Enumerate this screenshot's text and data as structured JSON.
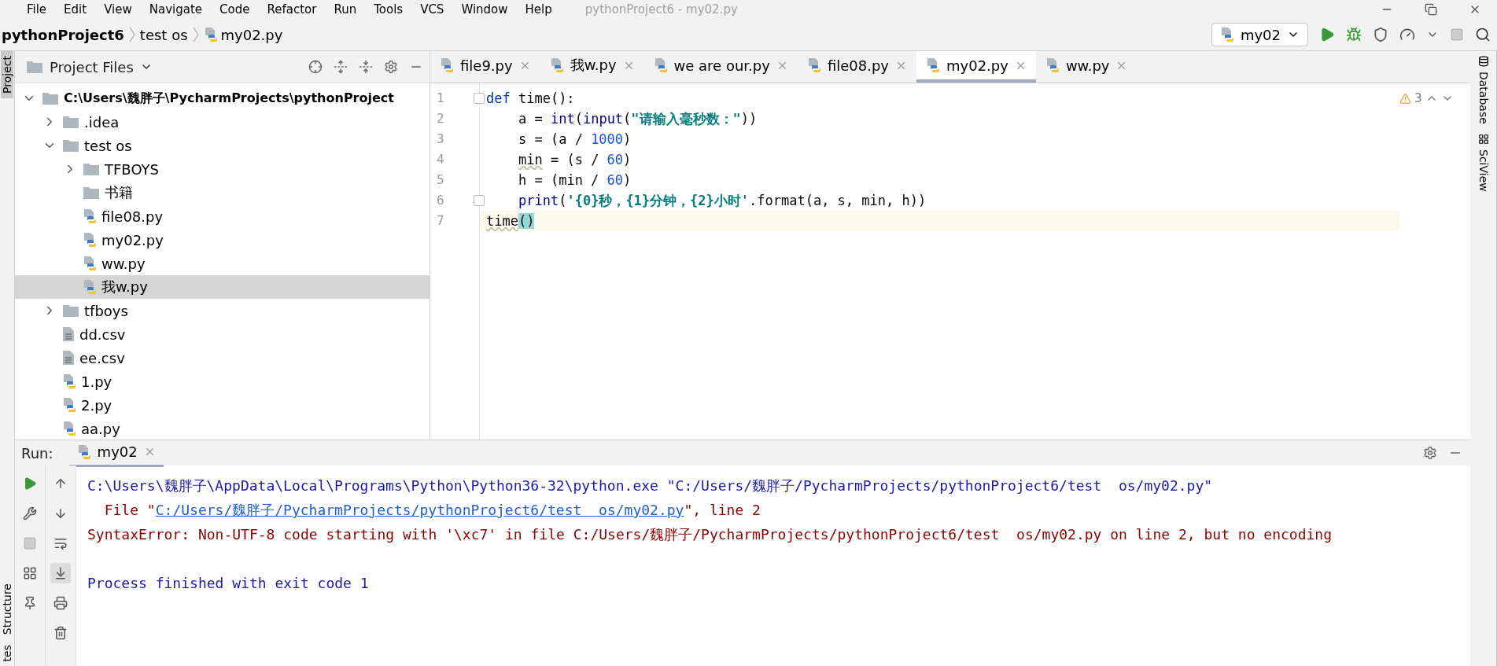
{
  "menu": [
    "File",
    "Edit",
    "View",
    "Navigate",
    "Code",
    "Refactor",
    "Run",
    "Tools",
    "VCS",
    "Window",
    "Help"
  ],
  "window_title": "pythonProject6 - my02.py",
  "breadcrumb": [
    "pythonProject6",
    "test  os",
    "my02.py"
  ],
  "run_config": {
    "label": "my02"
  },
  "left_stripe": {
    "top": "Project",
    "bottom": [
      "Structure",
      "tes"
    ]
  },
  "right_stripe": [
    "Database",
    "SciView"
  ],
  "project_panel": {
    "title": "Project Files",
    "tree": [
      {
        "label": "C:\\Users\\魏胖子\\PycharmProjects\\pythonProject",
        "kind": "root",
        "expanded": true,
        "selected": false,
        "children": [
          {
            "label": ".idea",
            "kind": "folder",
            "expanded": false,
            "selected": false
          },
          {
            "label": "test  os",
            "kind": "folder",
            "expanded": true,
            "selected": false,
            "children": [
              {
                "label": "TFBOYS",
                "kind": "folder",
                "expanded": false,
                "selected": false
              },
              {
                "label": "书籍",
                "kind": "folder",
                "selected": false
              },
              {
                "label": "file08.py",
                "kind": "python",
                "selected": false
              },
              {
                "label": "my02.py",
                "kind": "python",
                "selected": false
              },
              {
                "label": "ww.py",
                "kind": "python",
                "selected": false
              },
              {
                "label": "我w.py",
                "kind": "python",
                "selected": true
              }
            ]
          },
          {
            "label": "tfboys",
            "kind": "folder",
            "expanded": false,
            "selected": false
          },
          {
            "label": "dd.csv",
            "kind": "text",
            "selected": false
          },
          {
            "label": "ee.csv",
            "kind": "text",
            "selected": false
          },
          {
            "label": "1.py",
            "kind": "python",
            "selected": false
          },
          {
            "label": "2.py",
            "kind": "python",
            "selected": false
          },
          {
            "label": "aa.py",
            "kind": "python",
            "selected": false
          }
        ]
      }
    ]
  },
  "editor_tabs": [
    {
      "label": "file9.py",
      "selected": false
    },
    {
      "label": "我w.py",
      "selected": false
    },
    {
      "label": "we are our.py",
      "selected": false
    },
    {
      "label": "file08.py",
      "selected": false
    },
    {
      "label": "my02.py",
      "selected": true
    },
    {
      "label": "ww.py",
      "selected": false
    }
  ],
  "warnings": "3",
  "code_lines": [
    {
      "number": "1",
      "foldable": true,
      "indented": false,
      "current": false,
      "segments": [
        {
          "kind": "keyword",
          "text": "def"
        },
        {
          "kind": "plain",
          "text": " time():"
        }
      ]
    },
    {
      "number": "2",
      "foldable": false,
      "indented": true,
      "current": false,
      "segments": [
        {
          "kind": "plain",
          "text": "a = "
        },
        {
          "kind": "builtin",
          "text": "int"
        },
        {
          "kind": "plain",
          "text": "("
        },
        {
          "kind": "builtin",
          "text": "input"
        },
        {
          "kind": "plain",
          "text": "("
        },
        {
          "kind": "string",
          "text": "\"请输入毫秒数：\""
        },
        {
          "kind": "plain",
          "text": "))"
        }
      ]
    },
    {
      "number": "3",
      "foldable": false,
      "indented": true,
      "current": false,
      "segments": [
        {
          "kind": "plain",
          "text": "s = (a / "
        },
        {
          "kind": "number",
          "text": "1000"
        },
        {
          "kind": "plain",
          "text": ")"
        }
      ]
    },
    {
      "number": "4",
      "foldable": false,
      "indented": true,
      "current": false,
      "segments": [
        {
          "kind": "warn",
          "text": "min"
        },
        {
          "kind": "plain",
          "text": " = (s / "
        },
        {
          "kind": "number",
          "text": "60"
        },
        {
          "kind": "plain",
          "text": ")"
        }
      ]
    },
    {
      "number": "5",
      "foldable": false,
      "indented": true,
      "current": false,
      "segments": [
        {
          "kind": "plain",
          "text": "h = (min / "
        },
        {
          "kind": "number",
          "text": "60"
        },
        {
          "kind": "plain",
          "text": ")"
        }
      ]
    },
    {
      "number": "6",
      "foldable": true,
      "indented": true,
      "current": false,
      "segments": [
        {
          "kind": "builtin",
          "text": "print"
        },
        {
          "kind": "plain",
          "text": "("
        },
        {
          "kind": "string",
          "text": "'{0}秒，{1}分钟，{2}小时'"
        },
        {
          "kind": "plain",
          "text": ".format(a, s, min, h))"
        }
      ]
    },
    {
      "number": "7",
      "foldable": false,
      "indented": false,
      "current": true,
      "segments": [
        {
          "kind": "warn",
          "text": "time"
        },
        {
          "kind": "match",
          "text": "()"
        }
      ]
    }
  ],
  "run_panel": {
    "label": "Run:",
    "tab": "my02",
    "console": [
      {
        "segments": [
          {
            "kind": "cmd",
            "text": "C:\\Users\\魏胖子\\AppData\\Local\\Programs\\Python\\Python36-32\\python.exe \"C:/Users/魏胖子/PycharmProjects/pythonProject6/test  os/my02.py\""
          }
        ]
      },
      {
        "segments": [
          {
            "kind": "err",
            "text": "  File \""
          },
          {
            "kind": "link",
            "text": "C:/Users/魏胖子/PycharmProjects/pythonProject6/test  os/my02.py"
          },
          {
            "kind": "err",
            "text": "\", line 2"
          }
        ]
      },
      {
        "segments": [
          {
            "kind": "err",
            "text": "SyntaxError: Non-UTF-8 code starting with '\\xc7' in file C:/Users/魏胖子/PycharmProjects/pythonProject6/test  os/my02.py on line 2, but no encoding"
          }
        ]
      },
      {
        "segments": [
          {
            "kind": "cmd",
            "text": "Process finished with exit code 1"
          }
        ]
      }
    ]
  }
}
